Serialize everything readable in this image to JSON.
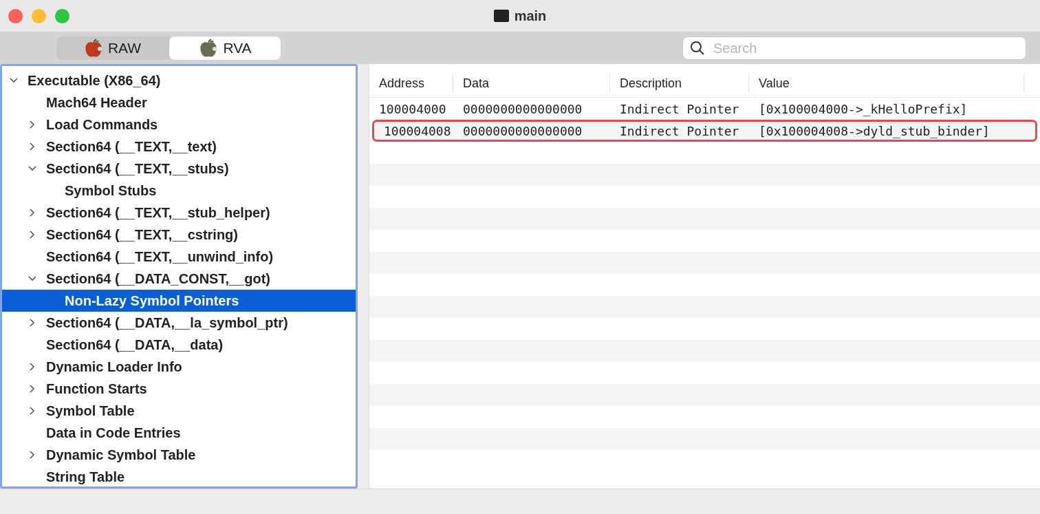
{
  "window": {
    "title": "main"
  },
  "mode_tabs": [
    {
      "label": "RAW",
      "selected": false
    },
    {
      "label": "RVA",
      "selected": true
    }
  ],
  "search": {
    "placeholder": "Search"
  },
  "tree": [
    {
      "label": "Executable  (X86_64)",
      "expanded": true,
      "selected": false,
      "children": [
        {
          "label": "Mach64 Header",
          "selected": false
        },
        {
          "label": "Load Commands",
          "expanded": false,
          "selected": false
        },
        {
          "label": "Section64 (__TEXT,__text)",
          "expanded": false,
          "selected": false
        },
        {
          "label": "Section64 (__TEXT,__stubs)",
          "expanded": true,
          "selected": false,
          "children": [
            {
              "label": "Symbol Stubs",
              "selected": false
            }
          ]
        },
        {
          "label": "Section64 (__TEXT,__stub_helper)",
          "expanded": false,
          "selected": false
        },
        {
          "label": "Section64 (__TEXT,__cstring)",
          "expanded": false,
          "selected": false
        },
        {
          "label": "Section64 (__TEXT,__unwind_info)",
          "selected": false
        },
        {
          "label": "Section64 (__DATA_CONST,__got)",
          "expanded": true,
          "selected": false,
          "children": [
            {
              "label": "Non-Lazy Symbol Pointers",
              "selected": true
            }
          ]
        },
        {
          "label": "Section64 (__DATA,__la_symbol_ptr)",
          "expanded": false,
          "selected": false
        },
        {
          "label": "Section64 (__DATA,__data)",
          "selected": false
        },
        {
          "label": "Dynamic Loader Info",
          "expanded": false,
          "selected": false
        },
        {
          "label": "Function Starts",
          "expanded": false,
          "selected": false
        },
        {
          "label": "Symbol Table",
          "expanded": false,
          "selected": false
        },
        {
          "label": "Data in Code Entries",
          "selected": false
        },
        {
          "label": "Dynamic Symbol Table",
          "expanded": false,
          "selected": false
        },
        {
          "label": "String Table",
          "selected": false
        }
      ]
    }
  ],
  "table": {
    "columns": [
      "Address",
      "Data",
      "Description",
      "Value"
    ],
    "rows": [
      {
        "cells": [
          "100004000",
          "0000000000000000",
          "Indirect Pointer",
          "[0x100004000->_kHelloPrefix]"
        ],
        "outlined": false
      },
      {
        "cells": [
          "100004008",
          "0000000000000000",
          "Indirect Pointer",
          "[0x100004008->dyld_stub_binder]"
        ],
        "outlined": true
      }
    ]
  }
}
